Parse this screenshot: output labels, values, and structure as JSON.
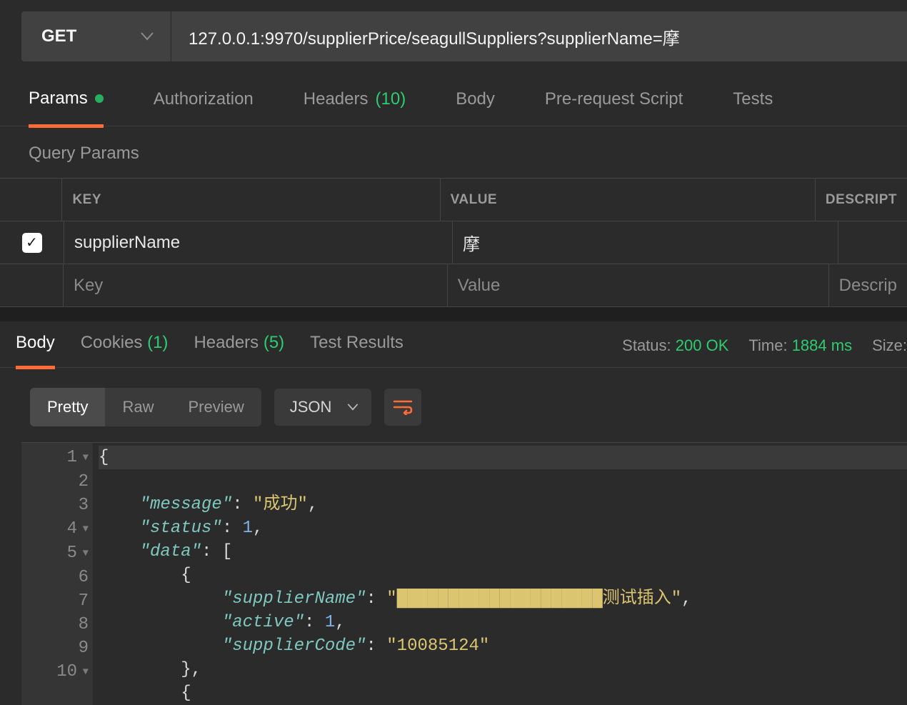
{
  "request": {
    "method": "GET",
    "url": "127.0.0.1:9970/supplierPrice/seagullSuppliers?supplierName=摩"
  },
  "reqTabs": {
    "params": "Params",
    "auth": "Authorization",
    "headers": "Headers",
    "headersCount": "(10)",
    "body": "Body",
    "prerequest": "Pre-request Script",
    "tests": "Tests"
  },
  "queryParams": {
    "title": "Query Params",
    "headerKey": "KEY",
    "headerValue": "VALUE",
    "headerDesc": "DESCRIPT",
    "rows": [
      {
        "enabled": true,
        "key": "supplierName",
        "value": "摩",
        "desc": ""
      }
    ],
    "placeholderKey": "Key",
    "placeholderValue": "Value",
    "placeholderDesc": "Descrip"
  },
  "respTabs": {
    "body": "Body",
    "cookies": "Cookies",
    "cookiesCount": "(1)",
    "headers": "Headers",
    "headersCount": "(5)",
    "testResults": "Test Results"
  },
  "respMeta": {
    "statusLabel": "Status:",
    "statusValue": "200 OK",
    "timeLabel": "Time:",
    "timeValue": "1884 ms",
    "sizeLabel": "Size:"
  },
  "viewModes": {
    "pretty": "Pretty",
    "raw": "Raw",
    "preview": "Preview",
    "format": "JSON"
  },
  "responseBody": {
    "message": "成功",
    "status": 1,
    "data": [
      {
        "supplierName": "████████████████████测试插入",
        "active": 1,
        "supplierCode": "10085124"
      }
    ]
  }
}
